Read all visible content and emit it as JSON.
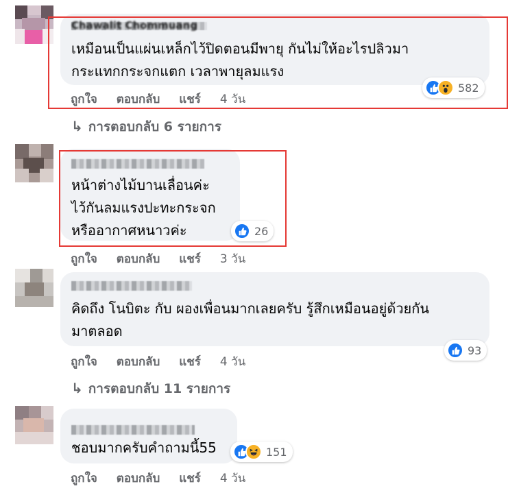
{
  "actions": {
    "like": "ถูกใจ",
    "reply": "ตอบกลับ",
    "share": "แชร์"
  },
  "comments": [
    {
      "author": "Chawalit Chommuang",
      "lines": [
        "เหมือนเป็นแผ่นเหล็กไว้ปิดตอนมีพายุ กันไม่ให้อะไรปลิวมา",
        "กระแทกกระจกแตก เวลาพายุลมแรง"
      ],
      "time": "4 วัน",
      "reaction_icons": [
        "like-icon",
        "wow-icon"
      ],
      "reaction_count": "582",
      "replies": "การตอบกลับ 6 รายการ"
    },
    {
      "lines": [
        "หน้าต่างไม้บานเลื่อนค่ะ",
        "ไว้กันลมแรงปะทะกระจก",
        "หรืออากาศหนาวค่ะ"
      ],
      "time": "3 วัน",
      "reaction_icons": [
        "like-icon"
      ],
      "reaction_count": "26"
    },
    {
      "lines": [
        "คิดถึง โนบิตะ กับ ผองเพื่อนมากเลยครับ รู้สึกเหมือนอยู่ด้วยกัน",
        "มาตลอด"
      ],
      "time": "4 วัน",
      "reaction_icons": [
        "like-icon"
      ],
      "reaction_count": "93",
      "replies": "การตอบกลับ 11 รายการ"
    },
    {
      "lines": [
        "ชอบมากครับคำถามนี้55"
      ],
      "time": "4 วัน",
      "reaction_icons": [
        "like-icon",
        "haha-icon"
      ],
      "reaction_count": "151"
    }
  ],
  "colors": {
    "highlight": "#e53935",
    "bubble": "#f0f2f5",
    "like": "#1877f2",
    "emoji": "#f7b125",
    "meta": "#65676b"
  }
}
